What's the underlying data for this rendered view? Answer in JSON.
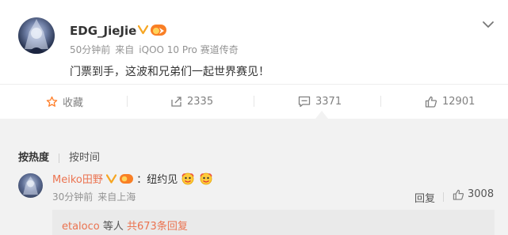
{
  "post": {
    "username": "EDG_JieJie",
    "time": "50分钟前",
    "source_prefix": "来自",
    "source": "iQOO 10 Pro 赛道传奇",
    "content": "门票到手，这波和兄弟们一起世界赛见！",
    "badges": {
      "verified_color": "#f6a623",
      "fan_color": "#f97f25"
    }
  },
  "actions": {
    "favorite_label": "收藏",
    "repost_count": "2335",
    "comment_count": "3371",
    "like_count": "12901"
  },
  "sort": {
    "hot_label": "按热度",
    "time_label": "按时间"
  },
  "comment": {
    "username": "Meiko田野",
    "text": "：纽约见",
    "time": "30分钟前",
    "location": "来自上海",
    "reply_label": "回复",
    "like_count": "3008"
  },
  "replies": {
    "user": "etaloco",
    "middle": " 等人 ",
    "count_text": "共673条回复"
  },
  "colors": {
    "accent": "#eb7350",
    "muted": "#939393"
  },
  "icons": [
    "more-chevron-icon",
    "verified-icon",
    "fan-badge-icon",
    "star-icon",
    "repost-icon",
    "comment-icon",
    "like-icon",
    "emoji-icon"
  ]
}
